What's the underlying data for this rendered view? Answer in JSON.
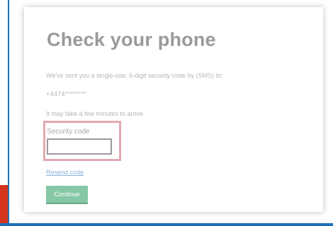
{
  "page": {
    "title": "Check your phone",
    "sent_message": "We've sent you a single-use, 6-digit security code by (SMS) to:",
    "phone_masked": "+4474********",
    "wait_note": "It may take a few minutes to arrive."
  },
  "form": {
    "code_label": "Security code",
    "code_value": "",
    "resend_link": "Resend code",
    "continue_button": "Continue"
  },
  "colors": {
    "accent_blue": "#1d70b8",
    "brand_red": "#d4351c",
    "button_green": "#86c8a6",
    "highlight_pink": "#e1a9b1"
  }
}
